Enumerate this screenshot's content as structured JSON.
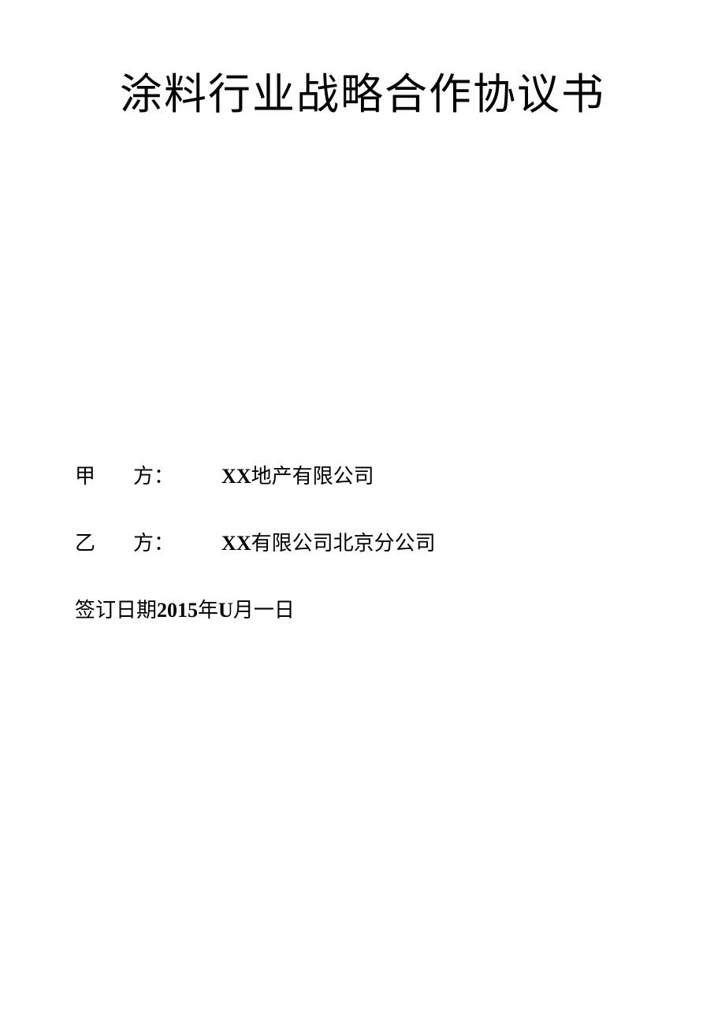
{
  "title": "涂料行业战略合作协议书",
  "party_a": {
    "label_char1": "甲",
    "label_char2": "方",
    "label_colon": "：",
    "prefix": "XX",
    "suffix": "地产有限公司"
  },
  "party_b": {
    "label_char1": "乙",
    "label_char2": "方",
    "label_colon": "：",
    "prefix": "XX",
    "suffix": "有限公司北京分公司"
  },
  "date": {
    "label": "签订日期",
    "year": "2015",
    "year_suffix": "年",
    "month": "U",
    "month_suffix": "月一日"
  }
}
